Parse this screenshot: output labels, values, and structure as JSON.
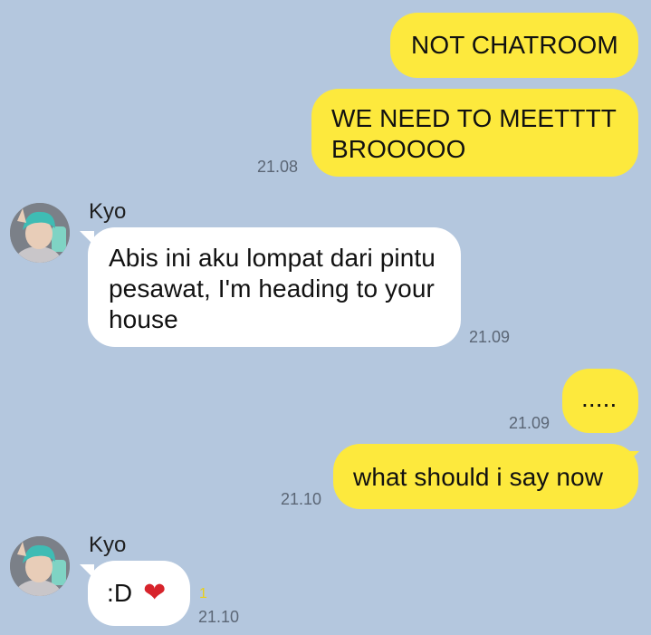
{
  "messages": [
    {
      "text": "NOT CHATROOM"
    },
    {
      "text": "WE NEED TO MEETTTT BROOOOO",
      "time": "21.08"
    },
    {
      "sender": "Kyo",
      "text": "Abis ini aku lompat dari pintu pesawat, I'm heading to your house",
      "time": "21.09"
    },
    {
      "text": ".....",
      "time": "21.09"
    },
    {
      "text": "what should i say now",
      "time": "21.10"
    },
    {
      "sender": "Kyo",
      "text": ":D",
      "emoji": "❤",
      "read_count": "1",
      "time": "21.10"
    }
  ],
  "colors": {
    "background": "#b4c7de",
    "outgoing_bubble": "#fde93d",
    "incoming_bubble": "#ffffff",
    "heart": "#d7232b"
  }
}
